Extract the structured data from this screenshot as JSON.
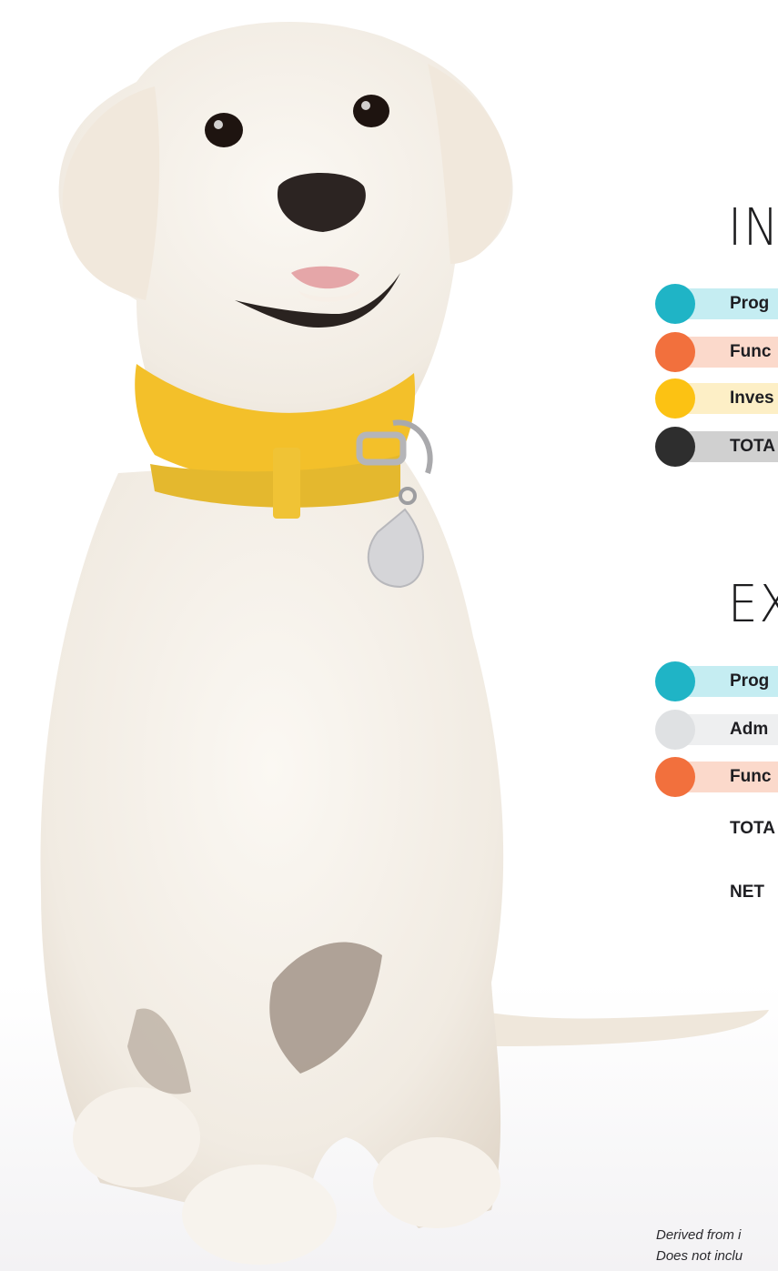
{
  "income": {
    "title": "IN",
    "items": [
      {
        "label": "Prog",
        "color": "#1fb4c6",
        "bar": "#c5edf2"
      },
      {
        "label": "Func",
        "color": "#f2703d",
        "bar": "#fbd9cb"
      },
      {
        "label": "Inves",
        "color": "#fcc213",
        "bar": "#fdefc6"
      },
      {
        "label": "TOTA",
        "color": "#2e2e2e",
        "bar": "#d0d0d0"
      }
    ]
  },
  "expenses": {
    "title": "EX",
    "items": [
      {
        "label": "Prog",
        "color": "#1fb4c6",
        "bar": "#c5edf2"
      },
      {
        "label": "Adm",
        "color": "#dfe1e3",
        "bar": "#eeeff0"
      },
      {
        "label": "Func",
        "color": "#f2703d",
        "bar": "#fbd9cb"
      }
    ],
    "total_label": "TOTA",
    "net_label": "NET"
  },
  "footnote": {
    "line1": "Derived from i",
    "line2": "Does not inclu"
  }
}
